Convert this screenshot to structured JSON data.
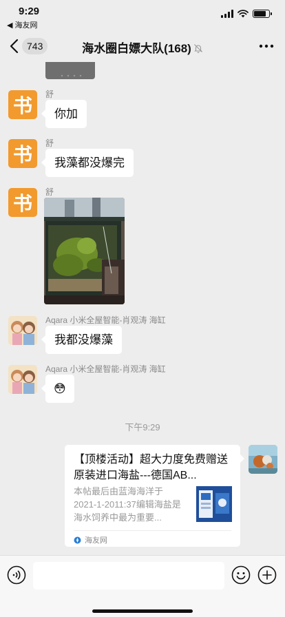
{
  "status_bar": {
    "time": "9:29",
    "back_app": "◀ 海友网"
  },
  "nav": {
    "unread_count": "743",
    "title": "海水圈白嫖大队(168)"
  },
  "messages": [
    {
      "sender": "舒",
      "avatar_char": "书",
      "text": "你加"
    },
    {
      "sender": "舒",
      "avatar_char": "书",
      "text": "我藻都没爆完"
    },
    {
      "sender": "舒",
      "avatar_char": "书",
      "type": "image"
    },
    {
      "sender": "Aqara 小米全屋智能-肖观涛 海缸",
      "text": "我都没爆藻"
    },
    {
      "sender": "Aqara 小米全屋智能-肖观涛 海缸",
      "text": "😳"
    }
  ],
  "time_divider": "下午9:29",
  "link_card": {
    "title": "【顶楼活动】超大力度免费赠送原装进口海盐---德国AB...",
    "description": "本帖最后由蓝海海洋于 2021-1-2011:37编辑海盐是海水饲养中最为重要...",
    "source": "海友网"
  },
  "icons": {
    "back": "chevron-left-icon",
    "mute": "bell-off-icon",
    "more": "more-dots-icon",
    "voice": "voice-icon",
    "emoji": "emoji-icon",
    "plus": "plus-icon"
  },
  "colors": {
    "background": "#ededed",
    "bubble": "#ffffff",
    "avatar_orange": "#f29a2e",
    "meta_text": "#8a8a8a"
  }
}
